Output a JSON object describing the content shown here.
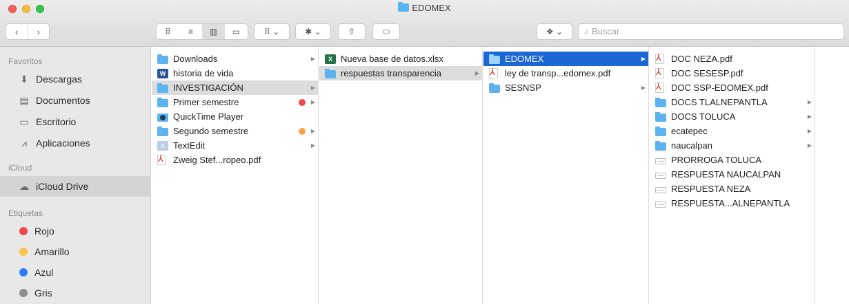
{
  "window": {
    "title": "EDOMEX"
  },
  "toolbar": {
    "back": "‹",
    "forward": "›",
    "view_icons": "⠿",
    "view_list": "≡",
    "view_columns": "▥",
    "view_gallery": "▭",
    "group": "⠿ ⌄",
    "action": "✱ ⌄",
    "share": "⇧",
    "tag": "⬭",
    "dropbox": "❖ ⌄",
    "search_placeholder": "Buscar"
  },
  "sidebar": {
    "favorites_header": "Favoritos",
    "favorites": [
      {
        "label": "Descargas",
        "icon": "download-icon"
      },
      {
        "label": "Documentos",
        "icon": "documents-icon"
      },
      {
        "label": "Escritorio",
        "icon": "desktop-icon"
      },
      {
        "label": "Aplicaciones",
        "icon": "applications-icon"
      }
    ],
    "icloud_header": "iCloud",
    "icloud_drive": "iCloud Drive",
    "tags_header": "Etiquetas",
    "tags": [
      {
        "label": "Rojo",
        "color": "#f2484a"
      },
      {
        "label": "Amarillo",
        "color": "#f8c44a"
      },
      {
        "label": "Azul",
        "color": "#2f7cf6"
      },
      {
        "label": "Gris",
        "color": "#8e8e93"
      }
    ]
  },
  "columns": [
    [
      {
        "name": "Downloads",
        "type": "folder",
        "arrow": true
      },
      {
        "name": "historia de vida",
        "type": "doc",
        "arrow": false
      },
      {
        "name": "INVESTIGACIÓN",
        "type": "folder",
        "arrow": true,
        "state": "gray"
      },
      {
        "name": "Primer semestre",
        "type": "folder",
        "arrow": true,
        "tag": "#f2484a"
      },
      {
        "name": "QuickTime Player",
        "type": "app",
        "arrow": false
      },
      {
        "name": "Segundo semestre",
        "type": "folder",
        "arrow": true,
        "tag": "#f7a54a"
      },
      {
        "name": "TextEdit",
        "type": "textedit",
        "arrow": true
      },
      {
        "name": "Zweig Stef...ropeo.pdf",
        "type": "pdf",
        "arrow": false
      }
    ],
    [
      {
        "name": "Nueva base de datos.xlsx",
        "type": "xls",
        "arrow": false
      },
      {
        "name": "respuestas transparencia",
        "type": "folder",
        "arrow": true,
        "state": "gray"
      }
    ],
    [
      {
        "name": "EDOMEX",
        "type": "folder",
        "arrow": true,
        "state": "blue"
      },
      {
        "name": "ley de transp...edomex.pdf",
        "type": "pdf",
        "arrow": false
      },
      {
        "name": "SESNSP",
        "type": "folder",
        "arrow": true
      }
    ],
    [
      {
        "name": "DOC NEZA.pdf",
        "type": "pdf",
        "arrow": false
      },
      {
        "name": "DOC SESESP.pdf",
        "type": "pdf",
        "arrow": false
      },
      {
        "name": "DOC SSP-EDOMEX.pdf",
        "type": "pdf",
        "arrow": false
      },
      {
        "name": "DOCS TLALNEPANTLA",
        "type": "folder",
        "arrow": true
      },
      {
        "name": "DOCS TOLUCA",
        "type": "folder",
        "arrow": true
      },
      {
        "name": "ecatepec",
        "type": "folder",
        "arrow": true
      },
      {
        "name": "naucalpan",
        "type": "folder",
        "arrow": true
      },
      {
        "name": "PRORROGA TOLUCA",
        "type": "file",
        "arrow": false
      },
      {
        "name": "RESPUESTA NAUCALPAN",
        "type": "file",
        "arrow": false
      },
      {
        "name": "RESPUESTA NEZA",
        "type": "file",
        "arrow": false
      },
      {
        "name": "RESPUESTA...ALNEPANTLA",
        "type": "file",
        "arrow": false
      }
    ]
  ]
}
